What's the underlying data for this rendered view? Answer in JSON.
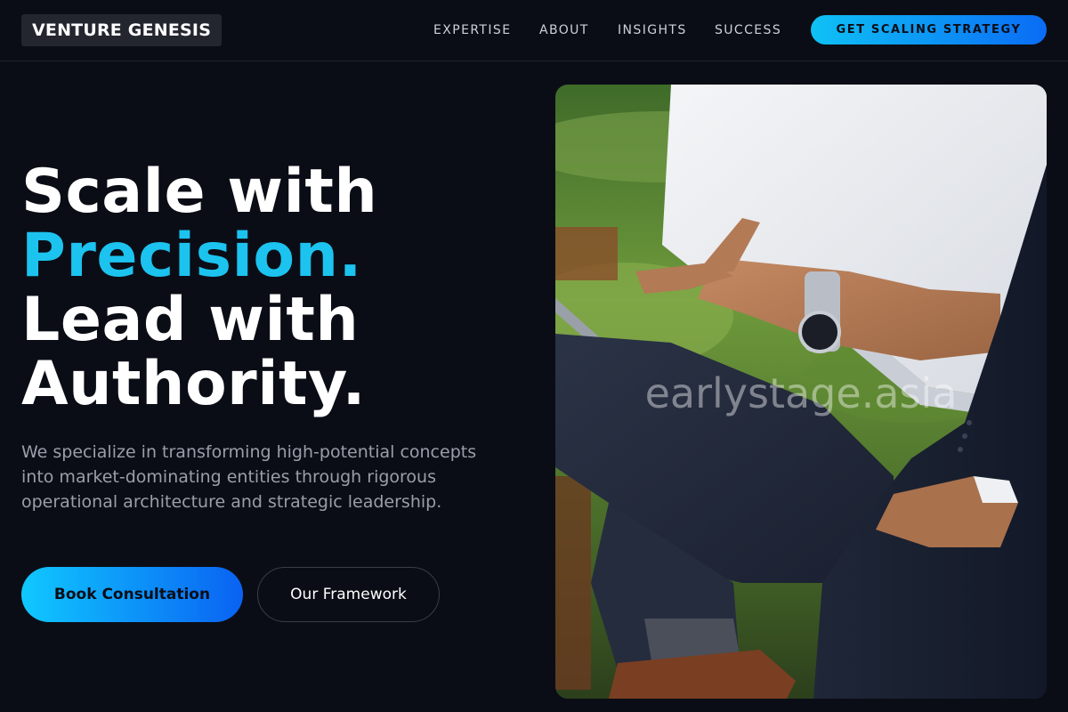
{
  "brand": {
    "logo_text": "VENTURE GENESIS"
  },
  "nav": {
    "links": [
      "EXPERTISE",
      "ABOUT",
      "INSIGHTS",
      "SUCCESS"
    ],
    "cta_label": "GET SCALING STRATEGY"
  },
  "hero": {
    "title_line1": "Scale with",
    "title_accent": "Precision.",
    "title_line3": "Lead with",
    "title_line4": "Authority.",
    "description": "We specialize in transforming high-potential concepts into market-dominating entities through rigorous operational architecture and strategic leadership.",
    "primary_button": "Book Consultation",
    "secondary_button": "Our Framework"
  },
  "image": {
    "watermark": "earlystage.asia"
  },
  "colors": {
    "background": "#0b0d16",
    "accent": "#1cc3ef",
    "gradient_start": "#10c8ff",
    "gradient_end": "#0a62f2"
  }
}
